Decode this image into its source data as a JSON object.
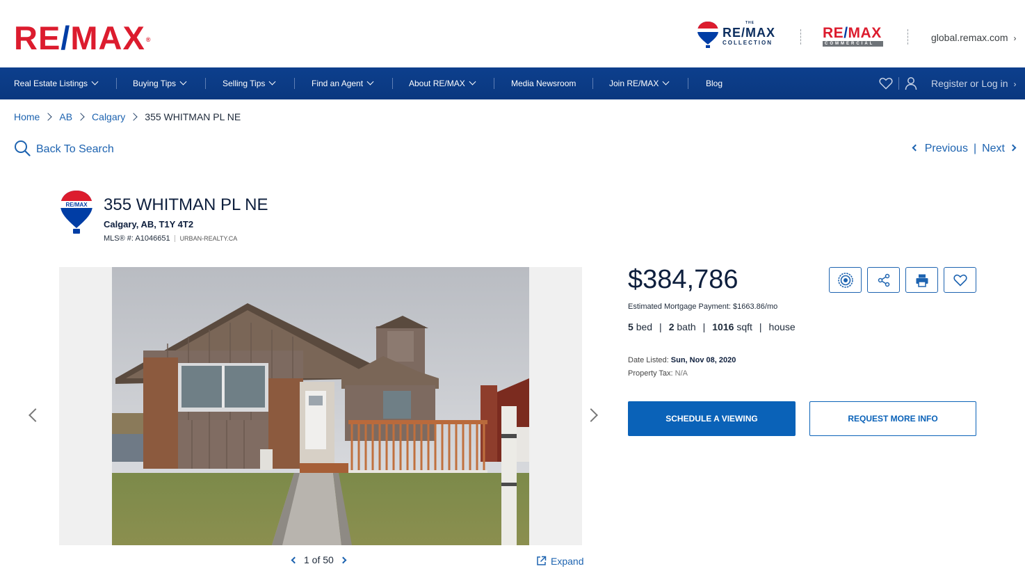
{
  "header": {
    "logo_prefix": "RE",
    "logo_slash": "/",
    "logo_suffix": "MAX",
    "logo_reg": "®",
    "collection": {
      "the": "THE",
      "brand": "RE/MAX",
      "sub": "COLLECTION"
    },
    "commercial": {
      "brand_prefix": "RE",
      "brand_slash": "/",
      "brand_suffix": "MAX",
      "sub": "COMMERCIAL"
    },
    "global_link": "global.remax.com"
  },
  "nav": {
    "items": [
      {
        "label": "Real Estate Listings",
        "dropdown": true
      },
      {
        "label": "Buying Tips",
        "dropdown": true
      },
      {
        "label": "Selling Tips",
        "dropdown": true
      },
      {
        "label": "Find an Agent",
        "dropdown": true
      },
      {
        "label": "About RE/MAX",
        "dropdown": true
      },
      {
        "label": "Media Newsroom",
        "dropdown": false
      },
      {
        "label": "Join RE/MAX",
        "dropdown": true
      },
      {
        "label": "Blog",
        "dropdown": false
      }
    ],
    "favorites_icon": "heart-icon",
    "user_icon": "user-icon",
    "login_label": "Register or Log in"
  },
  "breadcrumb": {
    "items": [
      "Home",
      "AB",
      "Calgary"
    ],
    "current": "355 WHITMAN PL NE"
  },
  "back_to_search": "Back To Search",
  "pagination_nav": {
    "previous": "Previous",
    "next": "Next",
    "separator": "|"
  },
  "listing": {
    "address": "355 WHITMAN PL NE",
    "city_line": "Calgary, AB, T1Y 4T2",
    "mls_label": "MLS® #: A1046651",
    "brokerage": "URBAN-REALTY.CA",
    "balloon_text": "RE/MAX",
    "price": "$384,786",
    "mortgage": "Estimated Mortgage Payment: $1663.86/mo",
    "beds_num": "5",
    "beds_label": "bed",
    "baths_num": "2",
    "baths_label": "bath",
    "sqft_num": "1016",
    "sqft_label": "sqft",
    "type": "house",
    "date_listed_label": "Date Listed:",
    "date_listed": "Sun, Nov 08, 2020",
    "tax_label": "Property Tax:",
    "tax_value": "N/A"
  },
  "gallery": {
    "counter": "1 of 50",
    "expand": "Expand"
  },
  "actions": {
    "icons": [
      "badge-icon",
      "share-icon",
      "print-icon",
      "favorite-icon"
    ],
    "schedule": "SCHEDULE A VIEWING",
    "request": "REQUEST MORE INFO"
  },
  "colors": {
    "brand_red": "#dc1c2e",
    "brand_blue": "#003da5",
    "nav_blue": "#0d3f8d",
    "link_blue": "#1d63b0",
    "button_blue": "#0a62b8"
  }
}
